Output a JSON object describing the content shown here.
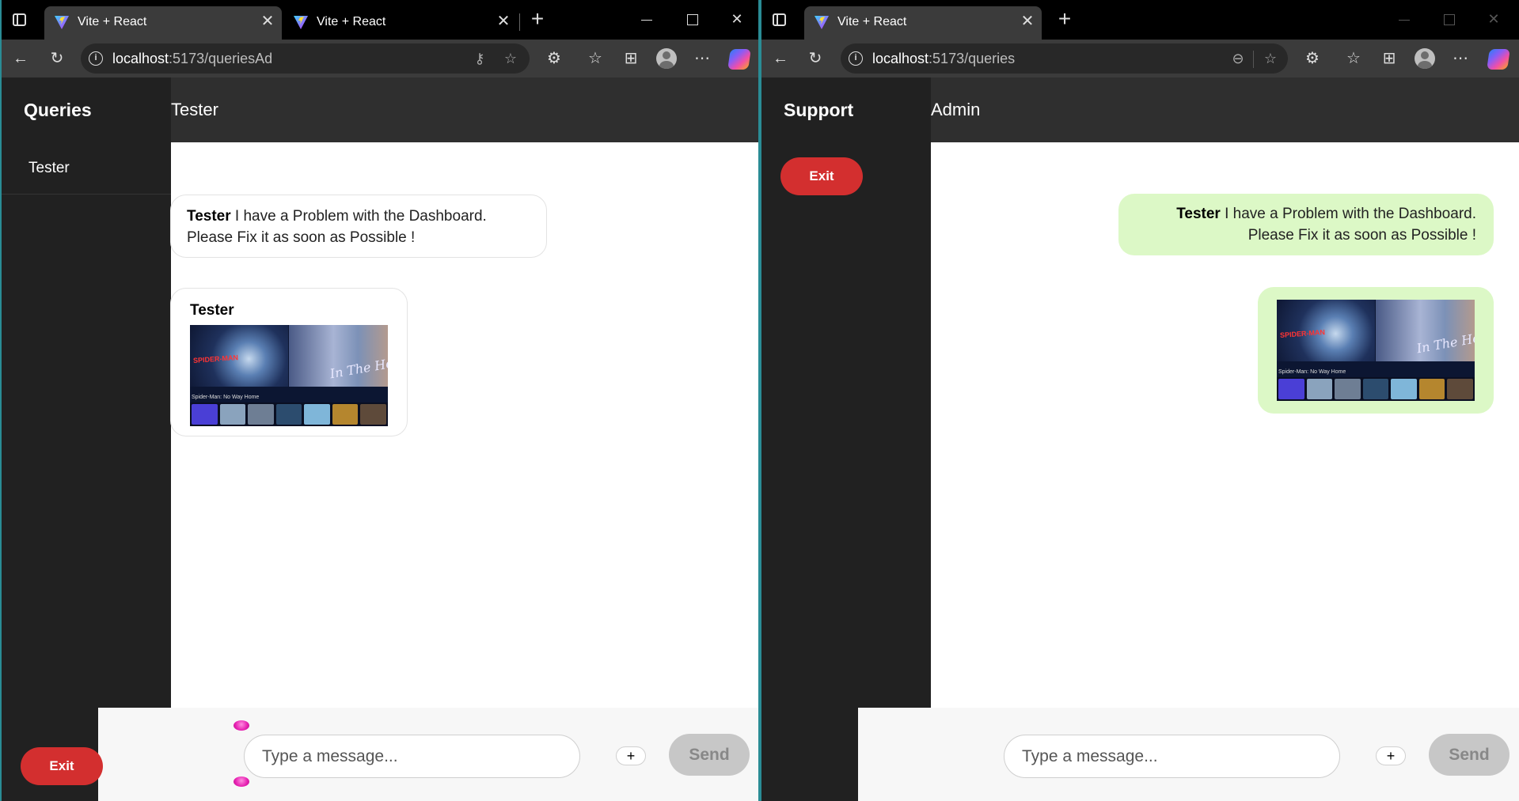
{
  "windows": {
    "left": {
      "tabs": [
        {
          "title": "Vite + React",
          "close": "✕"
        },
        {
          "title": "Vite + React",
          "close": "✕"
        }
      ],
      "url": {
        "host": "localhost",
        "path": ":5173/queriesAd"
      },
      "sidebar_title": "Queries",
      "sidebar_user": "Tester",
      "header_title": "Tester",
      "exit_label": "Exit",
      "messages": [
        {
          "sender": "Tester",
          "text": "I have a Problem with the Dashboard. Please Fix it as soon as Possible !"
        },
        {
          "sender": "Tester",
          "image": "screenshot-image"
        }
      ],
      "composer": {
        "placeholder": "Type a message...",
        "plus_label": "+",
        "send_label": "Send"
      }
    },
    "right": {
      "tabs": [
        {
          "title": "Vite + React",
          "close": "✕"
        }
      ],
      "url": {
        "host": "localhost",
        "path": ":5173/queries"
      },
      "sidebar_title": "Support",
      "header_title": "Admin",
      "exit_label": "Exit",
      "messages": [
        {
          "sender": "Tester",
          "text": "I have a Problem with the Dashboard. Please Fix it as soon as Possible !"
        },
        {
          "image": "screenshot-image"
        }
      ],
      "composer": {
        "placeholder": "Type a message...",
        "plus_label": "+",
        "send_label": "Send"
      }
    }
  },
  "thumbnail": {
    "left_title": "SPIDER-MAN",
    "right_title": "In The Heights",
    "caption": "Spider-Man: No Way Home"
  },
  "colors": {
    "exit_button": "#d32f2f",
    "outgoing_bubble": "#dcf8c6",
    "sidebar": "#212121",
    "header": "#2f2f2f"
  }
}
